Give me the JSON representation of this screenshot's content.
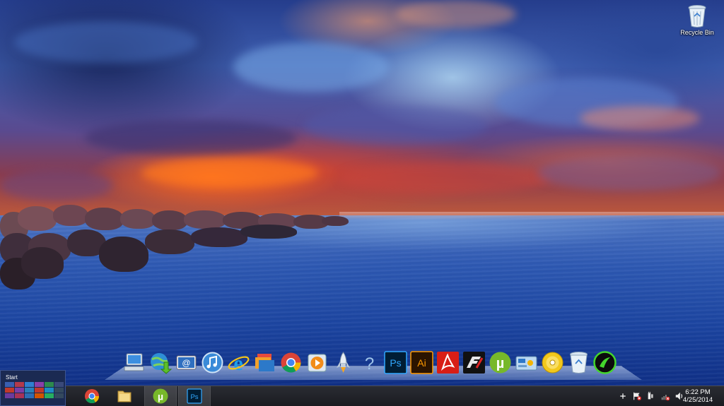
{
  "desktop": {
    "icons": [
      {
        "label": "Recycle Bin",
        "icon": "recycle-bin-icon"
      }
    ]
  },
  "dock": {
    "items": [
      {
        "name": "my-computer",
        "icon": "computer-icon"
      },
      {
        "name": "internet-download-manager",
        "icon": "globe-download-icon"
      },
      {
        "name": "email",
        "icon": "email-icon"
      },
      {
        "name": "itunes",
        "icon": "music-note-icon"
      },
      {
        "name": "internet-explorer",
        "icon": "ie-icon"
      },
      {
        "name": "file-explorer",
        "icon": "folders-icon"
      },
      {
        "name": "google-chrome",
        "icon": "chrome-icon"
      },
      {
        "name": "media-player",
        "icon": "play-icon"
      },
      {
        "name": "rocket",
        "icon": "rocket-icon"
      },
      {
        "name": "help",
        "icon": "question-icon"
      },
      {
        "name": "photoshop",
        "icon": "photoshop-icon",
        "text": "Ps"
      },
      {
        "name": "illustrator",
        "icon": "illustrator-icon",
        "text": "Ai"
      },
      {
        "name": "acrobat",
        "icon": "acrobat-icon"
      },
      {
        "name": "need-for-speed",
        "icon": "nfs-icon"
      },
      {
        "name": "utorrent",
        "icon": "utorrent-icon"
      },
      {
        "name": "control-panel",
        "icon": "control-panel-icon"
      },
      {
        "name": "dvd",
        "icon": "disc-icon"
      },
      {
        "name": "recycle-bin",
        "icon": "recycle-bin-icon"
      },
      {
        "name": "razer",
        "icon": "razer-icon"
      }
    ]
  },
  "start": {
    "label": "Start"
  },
  "taskbar": {
    "pinned": [
      {
        "name": "chrome",
        "icon": "chrome-icon",
        "active": false
      },
      {
        "name": "file-explorer",
        "icon": "folder-icon",
        "active": false
      },
      {
        "name": "utorrent",
        "icon": "utorrent-icon",
        "active": true
      },
      {
        "name": "photoshop",
        "icon": "photoshop-icon",
        "text": "Ps",
        "active": true
      }
    ],
    "tray": {
      "icons": [
        "show-hidden-icon",
        "flag-icon",
        "power-icon",
        "network-icon",
        "volume-icon"
      ],
      "time": "6:22 PM",
      "date": "4/25/2014"
    }
  },
  "colors": {
    "taskbar_bg": "#1a1b20",
    "start_tile_bg": "#1b2a52",
    "photoshop_blue": "#31a8ff",
    "illustrator_orange": "#ff9a00",
    "utorrent_green": "#77b82a"
  }
}
